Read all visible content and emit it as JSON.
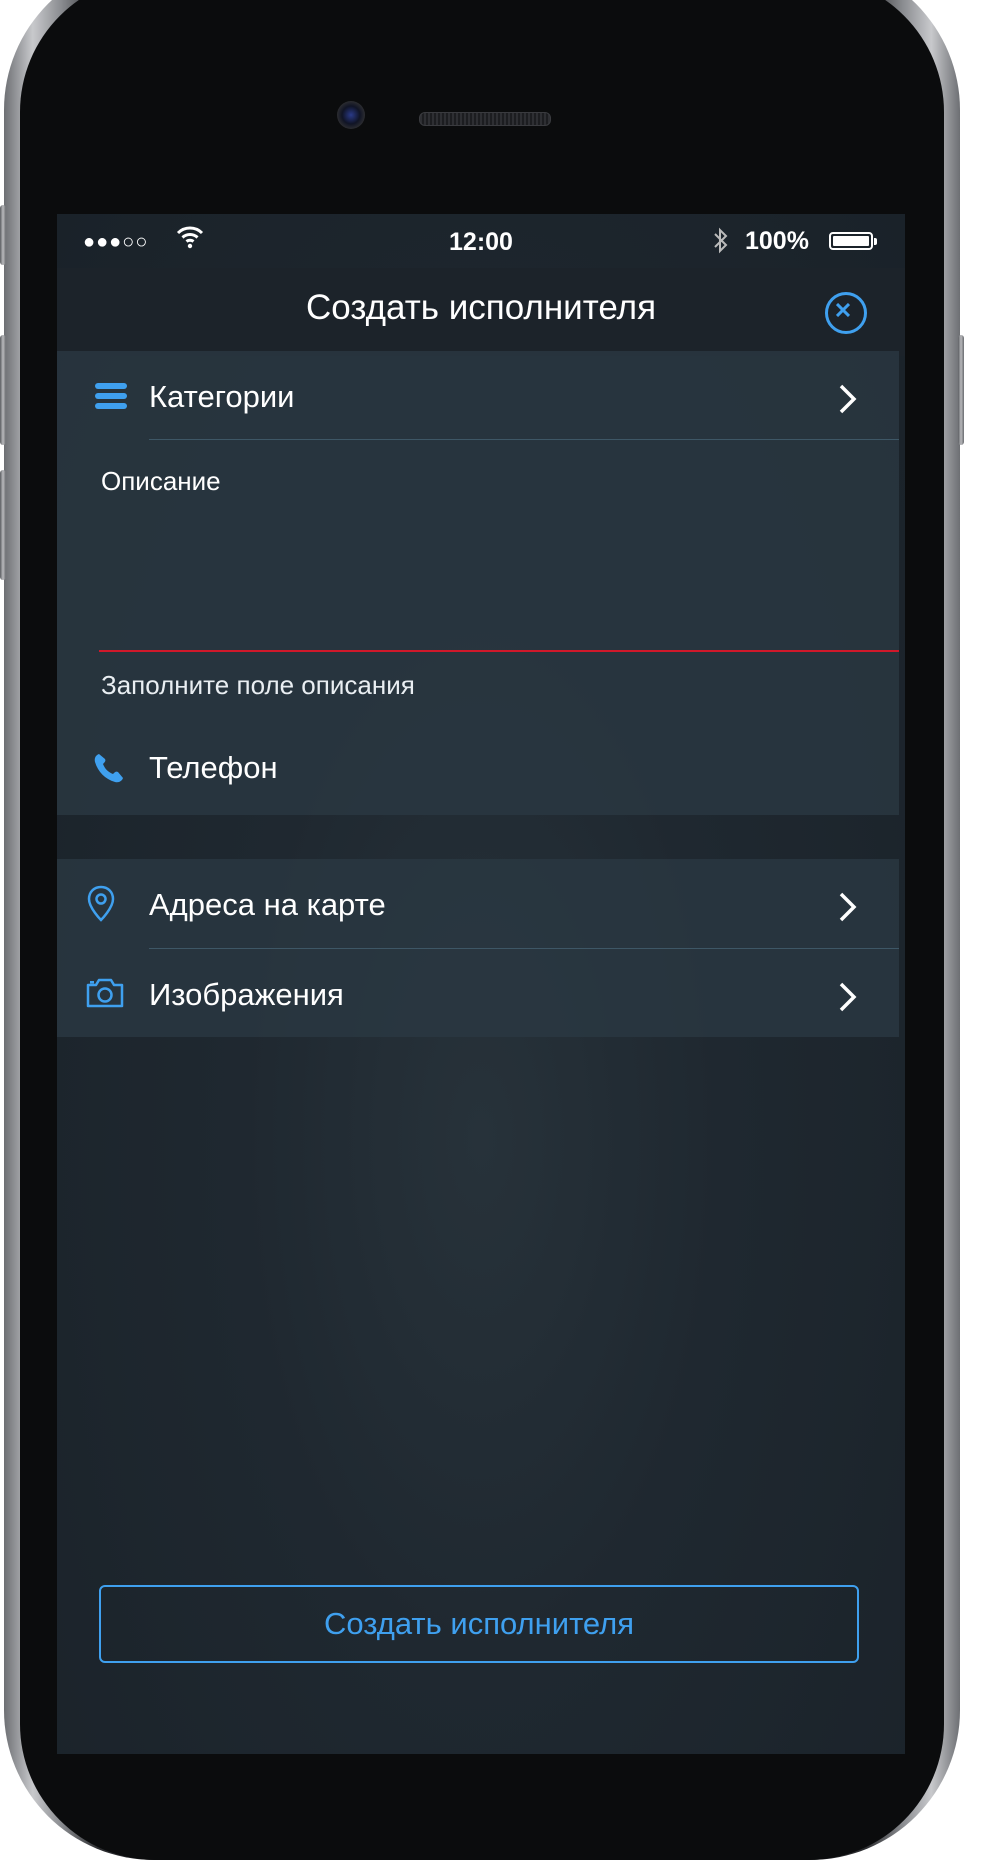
{
  "status_bar": {
    "signal": "●●●○○",
    "time": "12:00",
    "battery": "100%"
  },
  "nav": {
    "title": "Создать исполнителя",
    "close_icon": "close-circle-icon"
  },
  "form": {
    "categories": {
      "label": "Категории",
      "icon": "menu-icon"
    },
    "description": {
      "label": "Описание",
      "value": "",
      "error": "Заполните поле описания"
    },
    "phone": {
      "label": "Телефон",
      "icon": "phone-icon"
    },
    "addresses": {
      "label": "Адреса на карте",
      "icon": "map-pin-icon"
    },
    "images": {
      "label": "Изображения",
      "icon": "camera-icon"
    }
  },
  "submit": {
    "label": "Создать исполнителя"
  },
  "colors": {
    "accent": "#3fa0ef",
    "error": "#d0182a",
    "background": "#1f2830"
  }
}
